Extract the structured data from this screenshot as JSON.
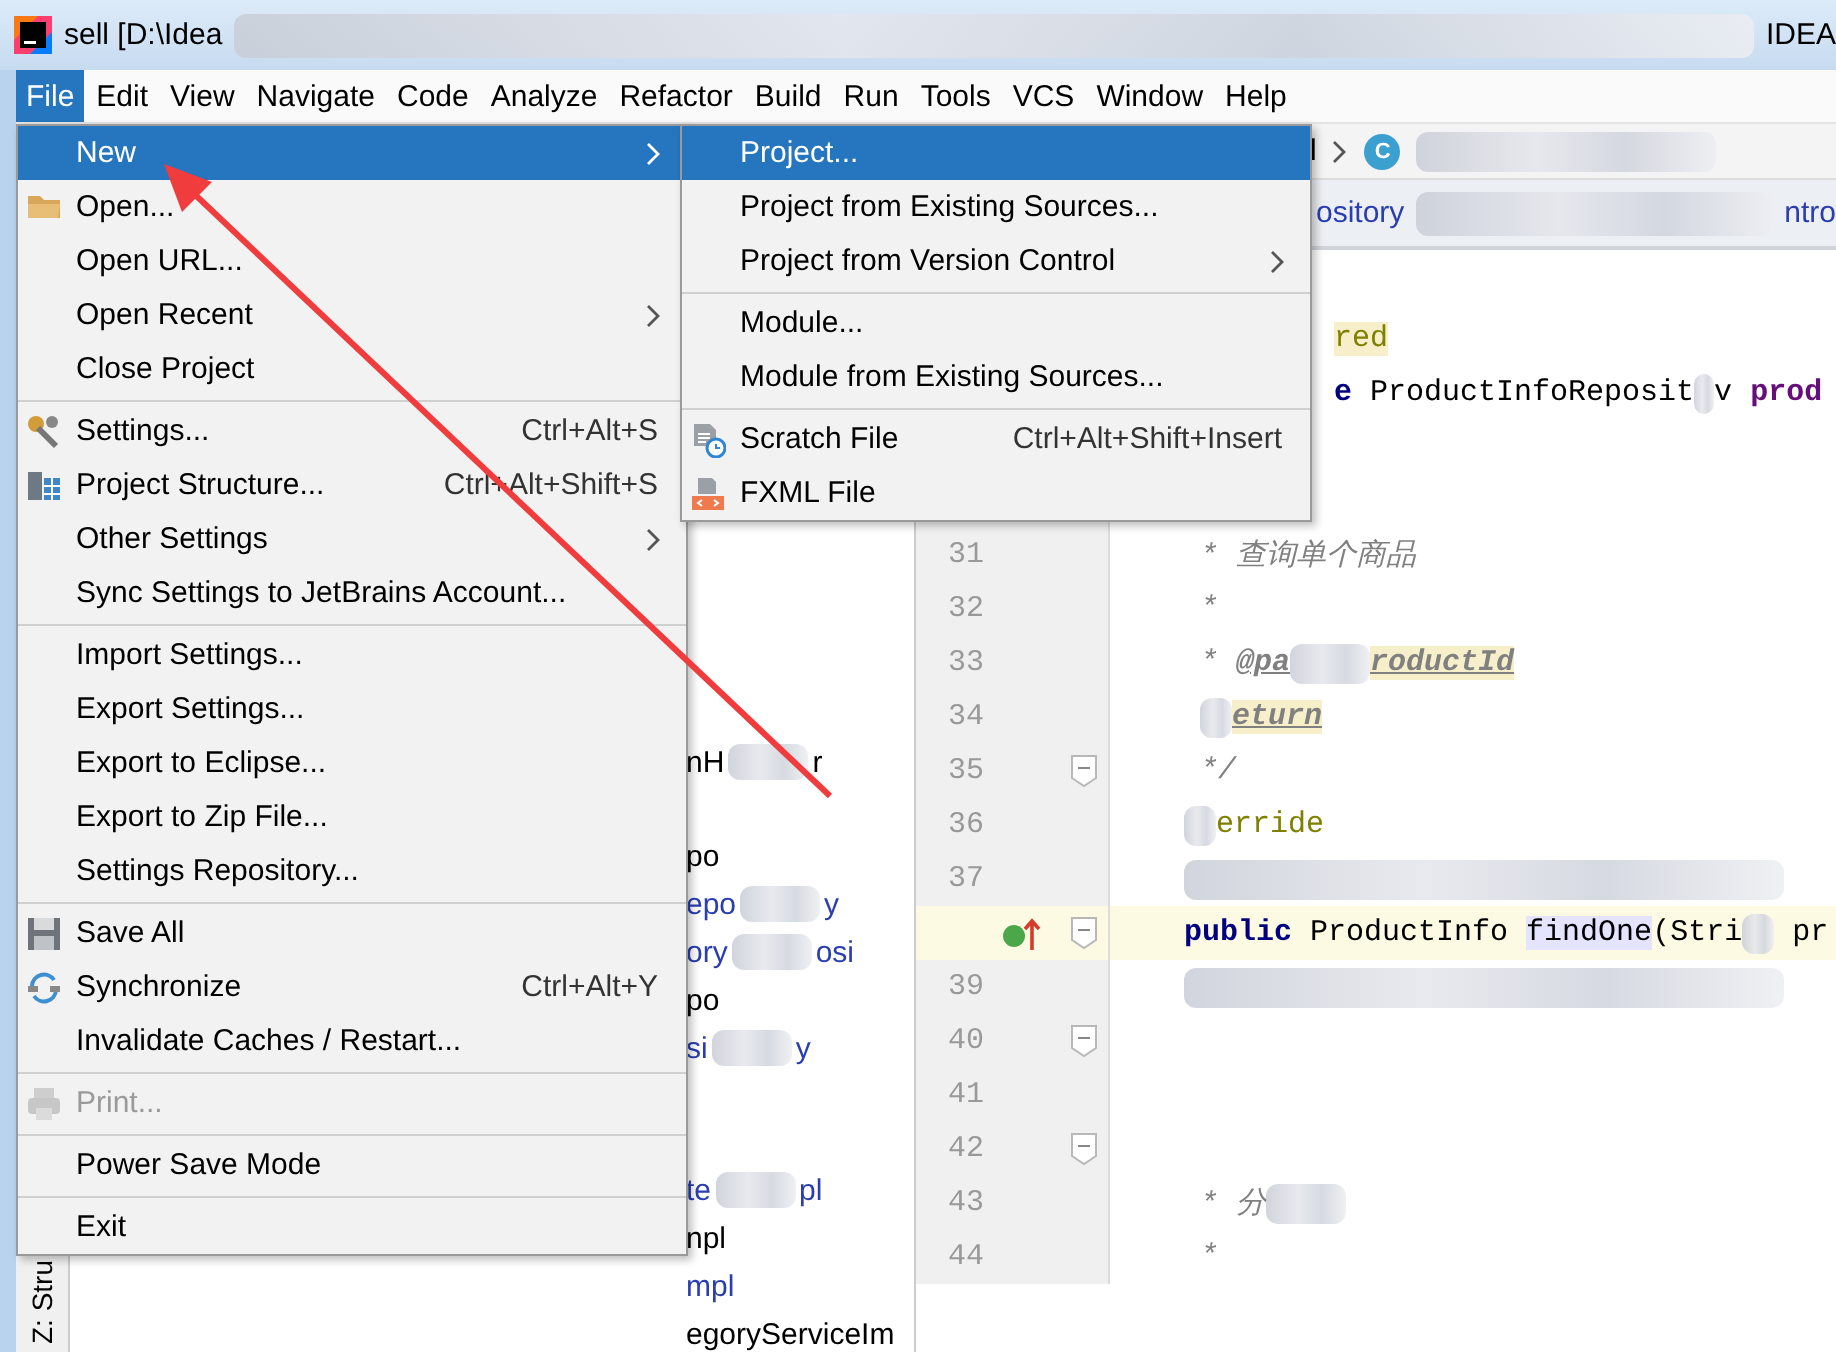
{
  "window": {
    "title_parts": [
      "sell [D:\\Idea",
      "IDEA"
    ]
  },
  "menu_bar": [
    {
      "label": "File",
      "selected": true
    },
    {
      "label": "Edit",
      "selected": false
    },
    {
      "label": "View",
      "selected": false
    },
    {
      "label": "Navigate",
      "selected": false
    },
    {
      "label": "Code",
      "selected": false
    },
    {
      "label": "Analyze",
      "selected": false
    },
    {
      "label": "Refactor",
      "selected": false
    },
    {
      "label": "Build",
      "selected": false
    },
    {
      "label": "Run",
      "selected": false
    },
    {
      "label": "Tools",
      "selected": false
    },
    {
      "label": "VCS",
      "selected": false
    },
    {
      "label": "Window",
      "selected": false
    },
    {
      "label": "Help",
      "selected": false
    }
  ],
  "breadcrumb": {
    "parts": [
      "l"
    ],
    "class_badge": "C"
  },
  "editor_tabs": {
    "parts": [
      "ository",
      "ntro"
    ]
  },
  "project_tree": {
    "groups": [
      [
        {
          "parts": [
            "nH",
            "r"
          ],
          "color": "#000000"
        }
      ],
      [
        {
          "parts": [
            "po"
          ],
          "color": "#000000"
        },
        {
          "parts": [
            "epo",
            "y"
          ],
          "color": "#2a3eb0"
        },
        {
          "parts": [
            "ory",
            "osi"
          ],
          "color": "#2a3eb0"
        },
        {
          "parts": [
            "po"
          ],
          "color": "#000000"
        },
        {
          "parts": [
            "si",
            "y"
          ],
          "color": "#2a3eb0"
        }
      ],
      [
        {
          "parts": [
            "te",
            "pl"
          ],
          "color": "#2a3eb0"
        },
        {
          "parts": [
            "npl"
          ],
          "color": "#000000"
        },
        {
          "parts": [
            "mpl"
          ],
          "color": "#2a3eb0"
        },
        {
          "parts": [
            "egoryServiceIm"
          ],
          "color": "#000000"
        }
      ]
    ]
  },
  "tool_strip": {
    "label": "Z: Stru"
  },
  "editor": {
    "covered_lines": [
      {
        "segments": [
          {
            "kind": "annotation-hl",
            "text": "red"
          }
        ]
      },
      {
        "segments": [
          {
            "kind": "keyword",
            "text": "e"
          },
          {
            "kind": "plain",
            "text": " ProductInfoReposit"
          },
          {
            "kind": "plain",
            "text": "v "
          },
          {
            "kind": "field",
            "text": "prod"
          }
        ]
      }
    ],
    "lines": [
      {
        "number": "31",
        "current": false,
        "fold": false,
        "segments": [
          {
            "kind": "comment",
            "text": "* 查询单个商品"
          }
        ]
      },
      {
        "number": "32",
        "current": false,
        "fold": false,
        "segments": [
          {
            "kind": "comment",
            "text": "*"
          }
        ]
      },
      {
        "number": "33",
        "current": false,
        "fold": false,
        "segments": [
          {
            "kind": "comment",
            "text": "* "
          },
          {
            "kind": "tag",
            "text": "@pa"
          },
          {
            "kind": "tag-hl",
            "text": "roductId"
          }
        ]
      },
      {
        "number": "34",
        "current": false,
        "fold": false,
        "segments": [
          {
            "kind": "tag-hl",
            "text": "eturn"
          }
        ]
      },
      {
        "number": "35",
        "current": false,
        "fold": true,
        "segments": [
          {
            "kind": "comment",
            "text": "*/"
          }
        ]
      },
      {
        "number": "36",
        "current": false,
        "fold": false,
        "segments": [
          {
            "kind": "annotation",
            "text": "erride"
          }
        ]
      },
      {
        "number": "37",
        "current": false,
        "fold": false
      },
      {
        "current": true,
        "fold": true,
        "segments": [
          {
            "kind": "keyword",
            "text": "public"
          },
          {
            "kind": "plain",
            "text": " ProductInfo "
          },
          {
            "kind": "plain-hl",
            "text": "findOne"
          },
          {
            "kind": "plain",
            "text": "(Stri"
          },
          {
            "kind": "plain",
            "text": " pr"
          }
        ]
      },
      {
        "number": "39",
        "current": false,
        "fold": false
      },
      {
        "number": "40",
        "current": false,
        "fold": true
      },
      {
        "number": "41",
        "current": false,
        "fold": false
      },
      {
        "number": "42",
        "current": false,
        "fold": true
      },
      {
        "number": "43",
        "current": false,
        "fold": false,
        "segments": [
          {
            "kind": "comment",
            "text": "* 分"
          }
        ]
      },
      {
        "number": "44",
        "current": false,
        "fold": false,
        "segments": [
          {
            "kind": "comment",
            "text": "*"
          }
        ]
      }
    ]
  },
  "file_menu": {
    "items": [
      {
        "kind": "item",
        "label": "New",
        "submenu": true,
        "selected": true,
        "disabled": false
      },
      {
        "kind": "item",
        "label": "Open...",
        "submenu": false,
        "selected": false,
        "disabled": false
      },
      {
        "kind": "item",
        "label": "Open URL...",
        "submenu": false,
        "selected": false,
        "disabled": false
      },
      {
        "kind": "item",
        "label": "Open Recent",
        "submenu": true,
        "selected": false,
        "disabled": false
      },
      {
        "kind": "item",
        "label": "Close Project",
        "submenu": false,
        "selected": false,
        "disabled": false
      },
      {
        "kind": "separator"
      },
      {
        "kind": "item",
        "label": "Settings...",
        "shortcut": "Ctrl+Alt+S",
        "submenu": false,
        "selected": false,
        "disabled": false
      },
      {
        "kind": "item",
        "label": "Project Structure...",
        "shortcut": "Ctrl+Alt+Shift+S",
        "submenu": false,
        "selected": false,
        "disabled": false
      },
      {
        "kind": "item",
        "label": "Other Settings",
        "submenu": true,
        "selected": false,
        "disabled": false
      },
      {
        "kind": "item",
        "label": "Sync Settings to JetBrains Account...",
        "submenu": false,
        "selected": false,
        "disabled": false
      },
      {
        "kind": "separator"
      },
      {
        "kind": "item",
        "label": "Import Settings...",
        "submenu": false,
        "selected": false,
        "disabled": false
      },
      {
        "kind": "item",
        "label": "Export Settings...",
        "submenu": false,
        "selected": false,
        "disabled": false
      },
      {
        "kind": "item",
        "label": "Export to Eclipse...",
        "submenu": false,
        "selected": false,
        "disabled": false
      },
      {
        "kind": "item",
        "label": "Export to Zip File...",
        "submenu": false,
        "selected": false,
        "disabled": false
      },
      {
        "kind": "item",
        "label": "Settings Repository...",
        "submenu": false,
        "selected": false,
        "disabled": false
      },
      {
        "kind": "separator"
      },
      {
        "kind": "item",
        "label": "Save All",
        "submenu": false,
        "selected": false,
        "disabled": false
      },
      {
        "kind": "item",
        "label": "Synchronize",
        "shortcut": "Ctrl+Alt+Y",
        "submenu": false,
        "selected": false,
        "disabled": false
      },
      {
        "kind": "item",
        "label": "Invalidate Caches / Restart...",
        "submenu": false,
        "selected": false,
        "disabled": false
      },
      {
        "kind": "separator"
      },
      {
        "kind": "item",
        "label": "Print...",
        "submenu": false,
        "selected": false,
        "disabled": true
      },
      {
        "kind": "separator"
      },
      {
        "kind": "item",
        "label": "Power Save Mode",
        "submenu": false,
        "selected": false,
        "disabled": false
      },
      {
        "kind": "separator"
      },
      {
        "kind": "item",
        "label": "Exit",
        "submenu": false,
        "selected": false,
        "disabled": false
      }
    ]
  },
  "new_submenu": {
    "items": [
      {
        "kind": "item",
        "label": "Project...",
        "submenu": false,
        "selected": true,
        "disabled": false
      },
      {
        "kind": "item",
        "label": "Project from Existing Sources...",
        "submenu": false,
        "selected": false,
        "disabled": false
      },
      {
        "kind": "item",
        "label": "Project from Version Control",
        "submenu": true,
        "selected": false,
        "disabled": false
      },
      {
        "kind": "separator"
      },
      {
        "kind": "item",
        "label": "Module...",
        "submenu": false,
        "selected": false,
        "disabled": false
      },
      {
        "kind": "item",
        "label": "Module from Existing Sources...",
        "submenu": false,
        "selected": false,
        "disabled": false
      },
      {
        "kind": "separator"
      },
      {
        "kind": "item",
        "label": "Scratch File",
        "shortcut": "Ctrl+Alt+Shift+Insert",
        "submenu": false,
        "selected": false,
        "disabled": false
      },
      {
        "kind": "item",
        "label": "FXML File",
        "submenu": false,
        "selected": false,
        "disabled": false
      }
    ]
  },
  "annotation_arrow": {
    "kind": "arrow"
  }
}
